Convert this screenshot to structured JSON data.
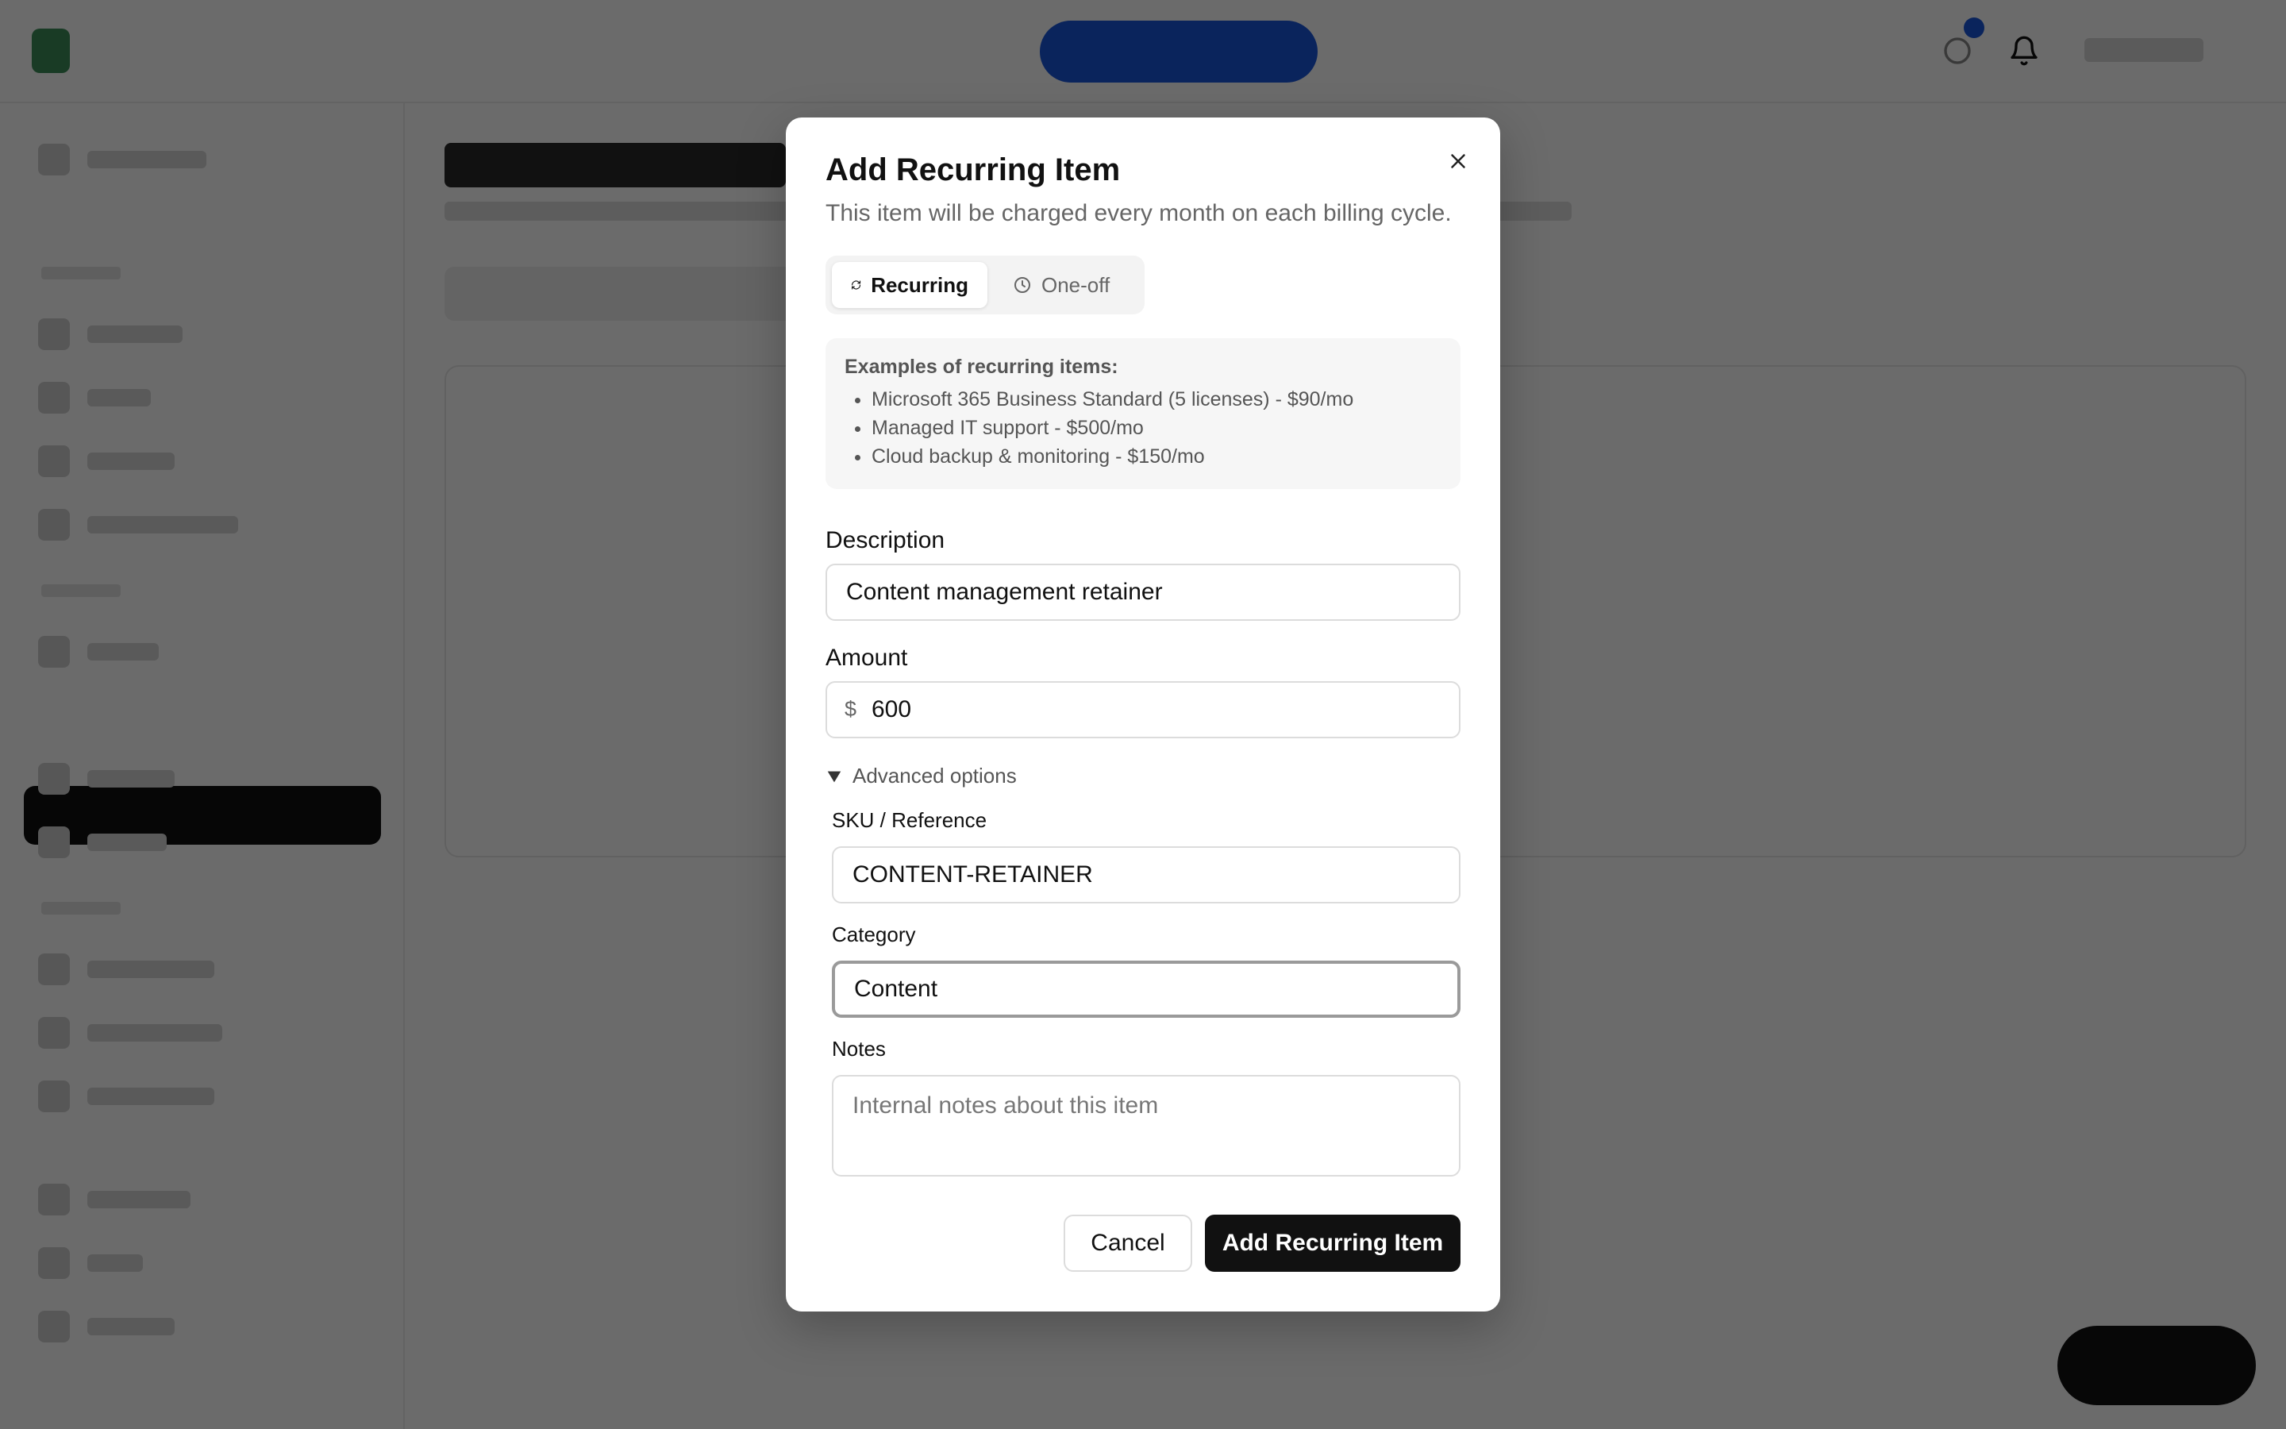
{
  "modal": {
    "title": "Add Recurring Item",
    "subtitle": "This item will be charged every month on each billing cycle.",
    "type_toggle": {
      "recurring_label": "Recurring",
      "oneoff_label": "One-off",
      "selected": "Recurring"
    },
    "examples": {
      "title": "Examples of recurring items:",
      "items": [
        "Microsoft 365 Business Standard (5 licenses) - $90/mo",
        "Managed IT support - $500/mo",
        "Cloud backup & monitoring - $150/mo"
      ]
    },
    "description": {
      "label": "Description",
      "value": "Content management retainer"
    },
    "amount": {
      "label": "Amount",
      "currency_symbol": "$",
      "value": "600"
    },
    "advanced": {
      "toggle_label": "Advanced options",
      "expanded": true,
      "sku": {
        "label": "SKU / Reference",
        "value": "CONTENT-RETAINER"
      },
      "category": {
        "label": "Category",
        "value": "Content"
      },
      "notes": {
        "label": "Notes",
        "placeholder": "Internal notes about this item",
        "value": ""
      }
    },
    "cancel_label": "Cancel",
    "submit_label": "Add Recurring Item"
  },
  "icons": {
    "close": "close-icon",
    "recurring": "refresh-icon",
    "oneoff": "clock-icon",
    "advanced": "triangle-down-icon",
    "notifications": "bell-icon"
  },
  "colors": {
    "overlay": "rgba(0,0,0,0.58)",
    "primary_button": "#111111",
    "accent": "#1a56db"
  }
}
